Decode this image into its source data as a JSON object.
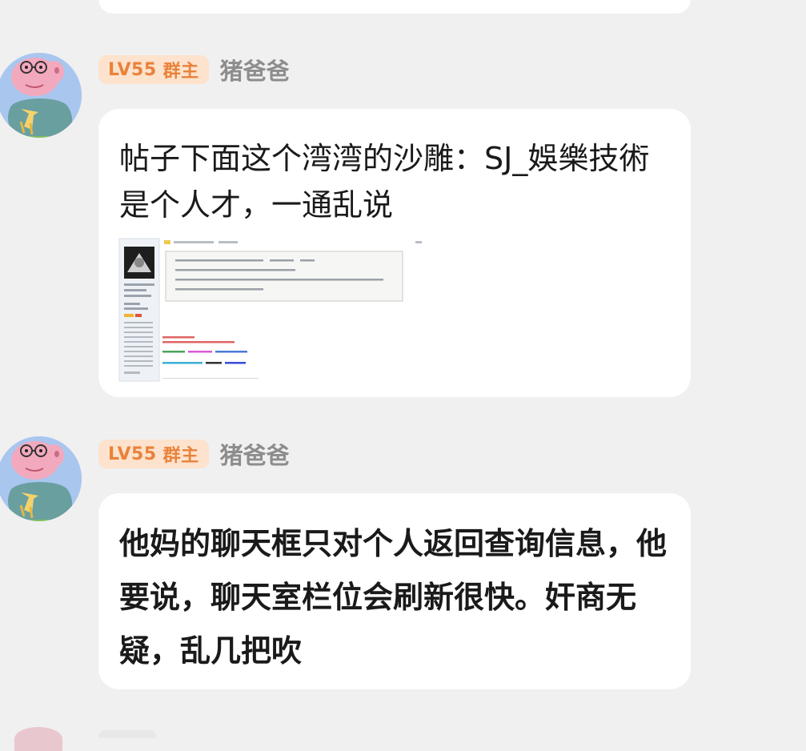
{
  "messages": [
    {
      "level": "LV55",
      "role": "群主",
      "username": "猪爸爸",
      "text": "帖子下面这个湾湾的沙雕：SJ_娛樂技術 是个人才，一通乱说",
      "has_image": true
    },
    {
      "level": "LV55",
      "role": "群主",
      "username": "猪爸爸",
      "text": "他妈的聊天框只对个人返回查询信息，他要说，聊天室栏位会刷新很快。奸商无疑，乱几把吹",
      "has_image": false
    }
  ],
  "colors": {
    "background": "#f0f0f0",
    "bubble": "#ffffff",
    "badge_bg": "#fde2cd",
    "badge_text": "#e9823a",
    "username": "#8d8d8d"
  }
}
